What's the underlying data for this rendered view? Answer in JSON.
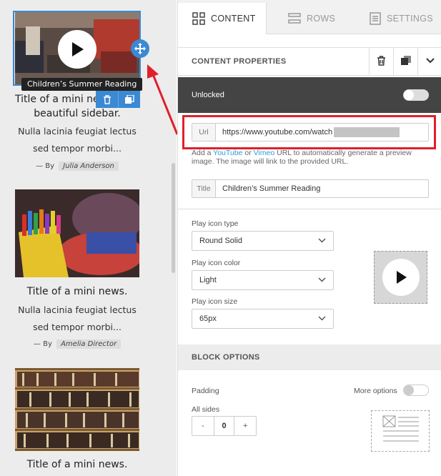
{
  "preview": {
    "items": [
      {
        "title_line1": "Title of a mini news.",
        "title_line2": "beautiful sidebar.",
        "body_line1": "Nulla lacinia feugiat lectus",
        "body_line2": "sed tempor morbi...",
        "by": "— By",
        "author": "Julia Anderson"
      },
      {
        "title": "Title of a mini news.",
        "body_line1": "Nulla lacinia feugiat lectus",
        "body_line2": "sed tempor morbi...",
        "by": "— By",
        "author": "Amelia Director"
      },
      {
        "title": "Title of a mini news."
      }
    ],
    "selected_caption": "Children’s Summer Reading",
    "title_partial": "Title of a mini ne"
  },
  "tabs": [
    {
      "label": "CONTENT",
      "active": true
    },
    {
      "label": "ROWS",
      "active": false
    },
    {
      "label": "SETTINGS",
      "active": false
    }
  ],
  "content_properties": {
    "heading": "CONTENT PROPERTIES",
    "unlocked_label": "Unlocked",
    "url_label": "Url",
    "url_value": "https://www.youtube.com/watch",
    "help_prefix": "Add a ",
    "help_link1": "YouTube",
    "help_or": " or ",
    "help_link2": "Vimeo",
    "help_suffix": " URL to automatically generate a preview image. The image will link to the provided URL.",
    "title_label": "Title",
    "title_value": "Children’s Summer Reading"
  },
  "play_icon": {
    "type_label": "Play icon type",
    "type_value": "Round Solid",
    "color_label": "Play icon color",
    "color_value": "Light",
    "size_label": "Play icon size",
    "size_value": "65px"
  },
  "block_options": {
    "heading": "BLOCK OPTIONS",
    "padding_label": "Padding",
    "more_options_label": "More options",
    "all_sides_label": "All sides",
    "minus": "-",
    "value": "0",
    "plus": "+"
  },
  "colors": {
    "accent": "#3b89d3",
    "highlight": "#e0202a",
    "link": "#2a9fd6",
    "dark_bar": "#444444"
  }
}
